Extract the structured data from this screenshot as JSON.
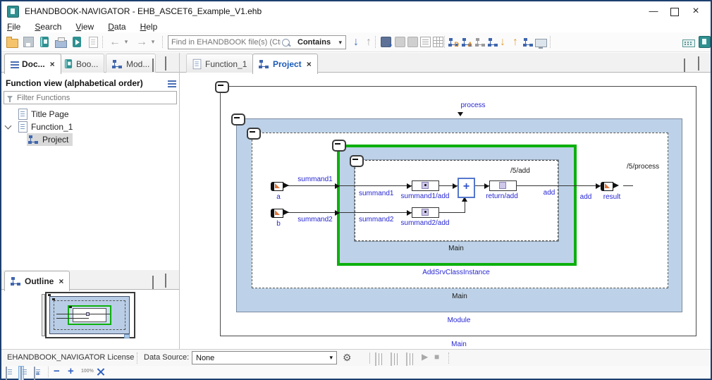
{
  "window": {
    "title": "EHANDBOOK-NAVIGATOR - EHB_ASCET6_Example_V1.ehb"
  },
  "menu": {
    "items": [
      {
        "label": "File"
      },
      {
        "label": "Search"
      },
      {
        "label": "View"
      },
      {
        "label": "Data"
      },
      {
        "label": "Help"
      }
    ]
  },
  "toolbar": {
    "find_placeholder": "Find in EHANDBOOK file(s) (Ctrl+H)",
    "contains_label": "Contains"
  },
  "left_panel": {
    "tabs": [
      {
        "label": "Doc..."
      },
      {
        "label": "Boo..."
      },
      {
        "label": "Mod..."
      }
    ],
    "header": "Function view (alphabetical order)",
    "filter_placeholder": "Filter Functions",
    "tree": {
      "items": [
        {
          "label": "Title Page"
        },
        {
          "label": "Function_1"
        },
        {
          "label": "Project"
        }
      ]
    }
  },
  "outline": {
    "tab_label": "Outline"
  },
  "main": {
    "tabs": [
      {
        "label": "Function_1"
      },
      {
        "label": "Project"
      }
    ]
  },
  "diagram": {
    "process_label": "process",
    "outer_main_label": "Main",
    "module_label": "Module",
    "mid_main_label": "Main",
    "class_label": "AddSrvClassInstance",
    "inner_main_label": "Main",
    "input_a": "a",
    "input_b": "b",
    "summand1_outer": "summand1",
    "summand2_outer": "summand2",
    "summand1_inner": "summand1",
    "summand2_inner": "summand2",
    "block_summand1": "summand1/add",
    "block_summand2": "summand2/add",
    "block_return": "return/add",
    "path_add": "/5/add",
    "add_inner": "add",
    "add_outer": "add",
    "result_label": "result",
    "path_process": "/5/process",
    "plus_op": "+"
  },
  "status_bar": {
    "license_label": "EHANDBOOK_NAVIGATOR License",
    "data_source_label": "Data Source:",
    "data_source_value": "None"
  },
  "icons": {
    "close": "×",
    "caret-down": "▾",
    "back-arrow": "←",
    "forward-arrow": "→",
    "arrow-down": "↓",
    "arrow-up": "↑",
    "minus": "−",
    "plus": "+",
    "play": "▶",
    "stop": "■",
    "window-minimize": "—",
    "pointer-down": "▼",
    "gear": "⚙",
    "zoom-100": "100%",
    "badge-d": "D",
    "badge-a": "A",
    "badge-plus": "+",
    "page-a": "a"
  },
  "colors": {
    "module_fill": "#bdd2e8",
    "highlight_green": "#0db00d",
    "label_blue": "#2727d3",
    "active_tab_blue": "#1b5cb8",
    "window_border": "#1e3f6f"
  }
}
